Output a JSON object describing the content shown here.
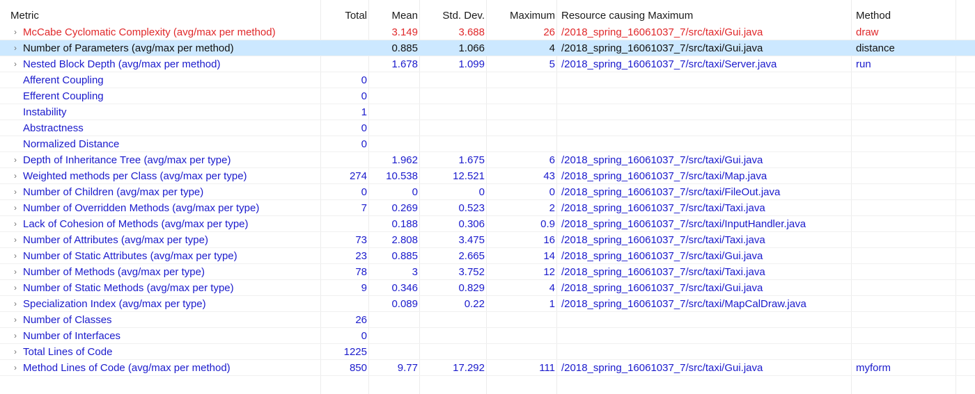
{
  "headers": {
    "metric": "Metric",
    "total": "Total",
    "mean": "Mean",
    "std_dev": "Std. Dev.",
    "maximum": "Maximum",
    "resource": "Resource causing Maximum",
    "method": "Method"
  },
  "colors": {
    "link_blue": "#1a1acc",
    "alert_red": "#e0282a",
    "selection": "#cce8ff"
  },
  "rows": [
    {
      "metric": "McCabe Cyclomatic Complexity (avg/max per method)",
      "expandable": true,
      "highlight": "red",
      "total": "",
      "mean": "3.149",
      "std": "3.688",
      "max": "26",
      "resource": "/2018_spring_16061037_7/src/taxi/Gui.java",
      "method": "draw"
    },
    {
      "metric": "Number of Parameters (avg/max per method)",
      "expandable": true,
      "selected": true,
      "total": "",
      "mean": "0.885",
      "std": "1.066",
      "max": "4",
      "resource": "/2018_spring_16061037_7/src/taxi/Gui.java",
      "method": "distance"
    },
    {
      "metric": "Nested Block Depth (avg/max per method)",
      "expandable": true,
      "total": "",
      "mean": "1.678",
      "std": "1.099",
      "max": "5",
      "resource": "/2018_spring_16061037_7/src/taxi/Server.java",
      "method": "run"
    },
    {
      "metric": "Afferent Coupling",
      "expandable": false,
      "total": "0",
      "mean": "",
      "std": "",
      "max": "",
      "resource": "",
      "method": ""
    },
    {
      "metric": "Efferent Coupling",
      "expandable": false,
      "total": "0",
      "mean": "",
      "std": "",
      "max": "",
      "resource": "",
      "method": ""
    },
    {
      "metric": "Instability",
      "expandable": false,
      "total": "1",
      "mean": "",
      "std": "",
      "max": "",
      "resource": "",
      "method": ""
    },
    {
      "metric": "Abstractness",
      "expandable": false,
      "total": "0",
      "mean": "",
      "std": "",
      "max": "",
      "resource": "",
      "method": ""
    },
    {
      "metric": "Normalized Distance",
      "expandable": false,
      "total": "0",
      "mean": "",
      "std": "",
      "max": "",
      "resource": "",
      "method": ""
    },
    {
      "metric": "Depth of Inheritance Tree (avg/max per type)",
      "expandable": true,
      "total": "",
      "mean": "1.962",
      "std": "1.675",
      "max": "6",
      "resource": "/2018_spring_16061037_7/src/taxi/Gui.java",
      "method": ""
    },
    {
      "metric": "Weighted methods per Class (avg/max per type)",
      "expandable": true,
      "total": "274",
      "mean": "10.538",
      "std": "12.521",
      "max": "43",
      "resource": "/2018_spring_16061037_7/src/taxi/Map.java",
      "method": ""
    },
    {
      "metric": "Number of Children (avg/max per type)",
      "expandable": true,
      "total": "0",
      "mean": "0",
      "std": "0",
      "max": "0",
      "resource": "/2018_spring_16061037_7/src/taxi/FileOut.java",
      "method": ""
    },
    {
      "metric": "Number of Overridden Methods (avg/max per type)",
      "expandable": true,
      "total": "7",
      "mean": "0.269",
      "std": "0.523",
      "max": "2",
      "resource": "/2018_spring_16061037_7/src/taxi/Taxi.java",
      "method": ""
    },
    {
      "metric": "Lack of Cohesion of Methods (avg/max per type)",
      "expandable": true,
      "total": "",
      "mean": "0.188",
      "std": "0.306",
      "max": "0.9",
      "resource": "/2018_spring_16061037_7/src/taxi/InputHandler.java",
      "method": ""
    },
    {
      "metric": "Number of Attributes (avg/max per type)",
      "expandable": true,
      "total": "73",
      "mean": "2.808",
      "std": "3.475",
      "max": "16",
      "resource": "/2018_spring_16061037_7/src/taxi/Taxi.java",
      "method": ""
    },
    {
      "metric": "Number of Static Attributes (avg/max per type)",
      "expandable": true,
      "total": "23",
      "mean": "0.885",
      "std": "2.665",
      "max": "14",
      "resource": "/2018_spring_16061037_7/src/taxi/Gui.java",
      "method": ""
    },
    {
      "metric": "Number of Methods (avg/max per type)",
      "expandable": true,
      "total": "78",
      "mean": "3",
      "std": "3.752",
      "max": "12",
      "resource": "/2018_spring_16061037_7/src/taxi/Taxi.java",
      "method": ""
    },
    {
      "metric": "Number of Static Methods (avg/max per type)",
      "expandable": true,
      "total": "9",
      "mean": "0.346",
      "std": "0.829",
      "max": "4",
      "resource": "/2018_spring_16061037_7/src/taxi/Gui.java",
      "method": ""
    },
    {
      "metric": "Specialization Index (avg/max per type)",
      "expandable": true,
      "total": "",
      "mean": "0.089",
      "std": "0.22",
      "max": "1",
      "resource": "/2018_spring_16061037_7/src/taxi/MapCalDraw.java",
      "method": ""
    },
    {
      "metric": "Number of Classes",
      "expandable": true,
      "total": "26",
      "mean": "",
      "std": "",
      "max": "",
      "resource": "",
      "method": ""
    },
    {
      "metric": "Number of Interfaces",
      "expandable": true,
      "total": "0",
      "mean": "",
      "std": "",
      "max": "",
      "resource": "",
      "method": ""
    },
    {
      "metric": "Total Lines of Code",
      "expandable": true,
      "total": "1225",
      "mean": "",
      "std": "",
      "max": "",
      "resource": "",
      "method": ""
    },
    {
      "metric": "Method Lines of Code (avg/max per method)",
      "expandable": true,
      "total": "850",
      "mean": "9.77",
      "std": "17.292",
      "max": "111",
      "resource": "/2018_spring_16061037_7/src/taxi/Gui.java",
      "method": "myform"
    }
  ],
  "icons": {
    "expand": "chevron-right-icon",
    "expand_glyph": "›"
  }
}
